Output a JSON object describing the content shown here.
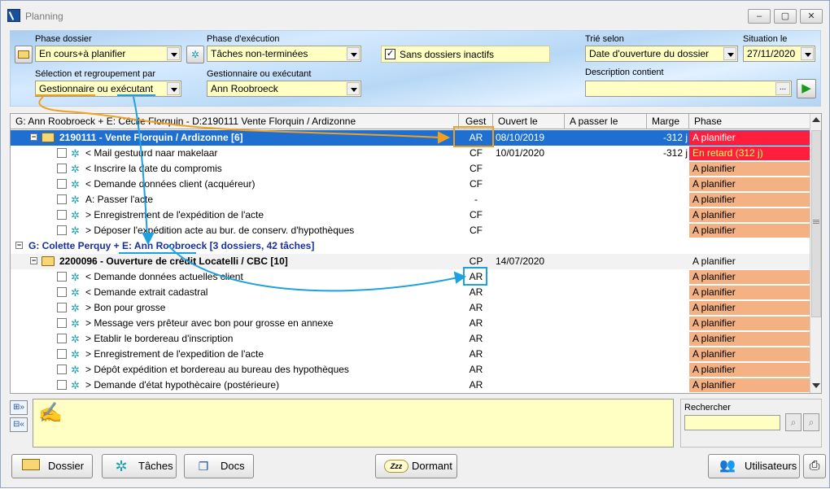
{
  "window": {
    "title": "Planning"
  },
  "filters": {
    "phase_dossier_label": "Phase dossier",
    "phase_dossier_value": "En cours+à planifier",
    "phase_execution_label": "Phase d'exécution",
    "phase_execution_value": "Tâches non-terminées",
    "sans_inactifs_label": "Sans dossiers inactifs",
    "sans_inactifs_checked": "✓",
    "trie_selon_label": "Trié selon",
    "trie_selon_value": "Date d'ouverture du dossier",
    "situation_label": "Situation le",
    "situation_value": "27/11/2020",
    "selection_label": "Sélection et regroupement par",
    "selection_value": "Gestionnaire ou exécutant",
    "gestionnaire_label": "Gestionnaire ou exécutant",
    "gestionnaire_value": "Ann Roobroeck",
    "description_label": "Description contient",
    "description_value": "",
    "ellipsis": "...",
    "go_arrow": "▶"
  },
  "grid": {
    "columns": {
      "group": "G: Ann Roobroeck + E: Cécile Florquin - D:2190111 Vente Florquin / Ardizonne",
      "gest": "Gest",
      "ouvert": "Ouvert le",
      "apasser": "A passer le",
      "marge": "Marge",
      "phase": "Phase"
    },
    "dossier1": {
      "title": "2190111 - Vente Florquin / Ardizonne [6]",
      "gest": "AR",
      "ouvert": "08/10/2019",
      "marge": "-312 j",
      "phase": "A planifier"
    },
    "tasks1": [
      {
        "label": "< Mail gestuurd naar makelaar",
        "gest": "CF",
        "ouvert": "10/01/2020",
        "marge": "-312 j",
        "phase": "En retard (312 j)"
      },
      {
        "label": "< Inscrire la date du compromis",
        "gest": "CF",
        "ouvert": "",
        "marge": "",
        "phase": "A planifier"
      },
      {
        "label": "< Demande données client (acquéreur)",
        "gest": "CF",
        "ouvert": "",
        "marge": "",
        "phase": "A planifier"
      },
      {
        "label": "A: Passer l'acte",
        "gest": "-",
        "ouvert": "",
        "marge": "",
        "phase": "A planifier"
      },
      {
        "label": "> Enregistrement de l'expédition de l'acte",
        "gest": "CF",
        "ouvert": "",
        "marge": "",
        "phase": "A planifier"
      },
      {
        "label": "> Déposer l'expédition acte au bur. de conserv. d'hypothèques",
        "gest": "CF",
        "ouvert": "",
        "marge": "",
        "phase": "A planifier"
      }
    ],
    "group2": {
      "title": "G: Colette Perquy + E: Ann Roobroeck [3 dossiers, 42 tâches]"
    },
    "dossier2": {
      "title": "2200096 - Ouverture de crédit Locatelli / CBC [10]",
      "gest": "CP",
      "ouvert": "14/07/2020",
      "marge": "",
      "phase": "A planifier"
    },
    "tasks2": [
      {
        "label": "< Demande données actuelles client",
        "gest": "AR",
        "phase": "A planifier"
      },
      {
        "label": "< Demande extrait cadastral",
        "gest": "AR",
        "phase": "A planifier"
      },
      {
        "label": "> Bon pour grosse",
        "gest": "AR",
        "phase": "A planifier"
      },
      {
        "label": "> Message vers prêteur avec bon pour grosse en annexe",
        "gest": "AR",
        "phase": "A planifier"
      },
      {
        "label": "> Etablir le bordereau d'inscription",
        "gest": "AR",
        "phase": "A planifier"
      },
      {
        "label": "> Enregistrement de l'expedition de l'acte",
        "gest": "AR",
        "phase": "A planifier"
      },
      {
        "label": "> Dépôt expédition et bordereau au bureau des hypothèques",
        "gest": "AR",
        "phase": "A planifier"
      },
      {
        "label": "> Demande d'état hypothècaire (postérieure)",
        "gest": "AR",
        "phase": "A planifier"
      }
    ]
  },
  "search": {
    "label": "Rechercher",
    "value": ""
  },
  "buttons": {
    "dossier": "Dossier",
    "taches": "Tâches",
    "docs": "Docs",
    "dormant": "Dormant",
    "utilisateurs": "Utilisateurs",
    "zzz": "Zzz"
  },
  "colors": {
    "selected_row": "#1e6fcf",
    "planifier": "#f4b184",
    "retard": "#ff1f3d",
    "accent_orange": "#f0a020",
    "accent_blue": "#1fa0e0"
  }
}
